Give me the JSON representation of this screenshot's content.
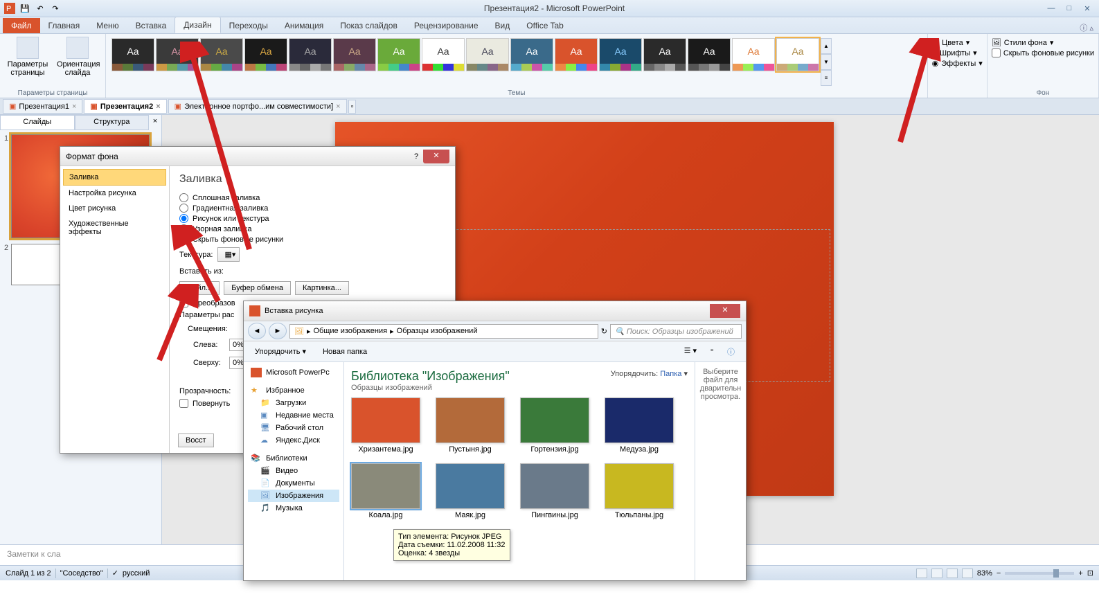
{
  "app": {
    "title": "Презентация2 - Microsoft PowerPoint"
  },
  "ribbon": {
    "file": "Файл",
    "tabs": [
      "Главная",
      "Меню",
      "Вставка",
      "Дизайн",
      "Переходы",
      "Анимация",
      "Показ слайдов",
      "Рецензирование",
      "Вид",
      "Office Tab"
    ],
    "active_tab": "Дизайн",
    "group_page_setup": {
      "label": "Параметры страницы",
      "page_setup": "Параметры страницы",
      "orientation": "Ориентация слайда"
    },
    "group_themes": {
      "label": "Темы"
    },
    "group_background": {
      "label": "Фон",
      "colors": "Цвета",
      "fonts": "Шрифты",
      "effects": "Эффекты",
      "styles": "Стили фона",
      "hide": "Скрыть фоновые рисунки"
    }
  },
  "doc_tabs": [
    {
      "label": "Презентация1"
    },
    {
      "label": "Презентация2"
    },
    {
      "label": "Электронное портфо...им совместимости]"
    }
  ],
  "slide_panel": {
    "tab_slides": "Слайды",
    "tab_outline": "Структура"
  },
  "notes": "Заметки к сла",
  "statusbar": {
    "slide": "Слайд 1 из 2",
    "theme": "\"Соседство\"",
    "language": "русский",
    "zoom": "83%"
  },
  "dlg_fb": {
    "title": "Формат фона",
    "nav": [
      "Заливка",
      "Настройка рисунка",
      "Цвет рисунка",
      "Художественные эффекты"
    ],
    "heading": "Заливка",
    "opt_solid": "Сплошная заливка",
    "opt_gradient": "Градиентная заливка",
    "opt_picture": "Рисунок или текстура",
    "opt_pattern": "Узорная заливка",
    "opt_hide": "Скрыть фоновые рисунки",
    "texture": "Текстура:",
    "insert_from": "Вставить из:",
    "btn_file": "Файл...",
    "btn_clipboard": "Буфер обмена",
    "btn_clipart": "Картинка...",
    "chk_tile": "Преобразов",
    "stretch_params": "Параметры рас",
    "offsets": "Смещения:",
    "left": "Слева:",
    "left_val": "0%",
    "top": "Сверху:",
    "top_val": "0%",
    "transparency": "Прозрачность:",
    "rotate": "Повернуть",
    "btn_reset": "Восст"
  },
  "dlg_ip": {
    "title": "Вставка рисунка",
    "path1": "Общие изображения",
    "path2": "Образцы изображений",
    "search_placeholder": "Поиск: Образцы изображений",
    "btn_organize": "Упорядочить",
    "btn_newfolder": "Новая папка",
    "side_powerpoint": "Microsoft PowerPc",
    "side_favorites": "Избранное",
    "side_downloads": "Загрузки",
    "side_recent": "Недавние места",
    "side_desktop": "Рабочий стол",
    "side_yadisk": "Яндекс.Диск",
    "side_libraries": "Библиотеки",
    "side_videos": "Видео",
    "side_documents": "Документы",
    "side_pictures": "Изображения",
    "side_music": "Музыка",
    "lib_title": "Библиотека \"Изображения\"",
    "lib_sub": "Образцы изображений",
    "arrange": "Упорядочить:",
    "arrange_val": "Папка",
    "files": [
      {
        "name": "Хризантема.jpg",
        "color": "#d9532c"
      },
      {
        "name": "Пустыня.jpg",
        "color": "#b36a3a"
      },
      {
        "name": "Гортензия.jpg",
        "color": "#3a7a3a"
      },
      {
        "name": "Медуза.jpg",
        "color": "#1a2a6a"
      },
      {
        "name": "Коала.jpg",
        "color": "#8a8a7a"
      },
      {
        "name": "Маяк.jpg",
        "color": "#4a7aa0"
      },
      {
        "name": "Пингвины.jpg",
        "color": "#6a7a8a"
      },
      {
        "name": "Тюльпаны.jpg",
        "color": "#c8b820"
      }
    ],
    "preview_hint": "Выберите файл для дварительн просмотра.",
    "tooltip": {
      "l1": "Тип элемента: Рисунок JPEG",
      "l2": "Дата съемки: 11.02.2008 11:32",
      "l3": "Оценка: 4 звезды"
    }
  }
}
